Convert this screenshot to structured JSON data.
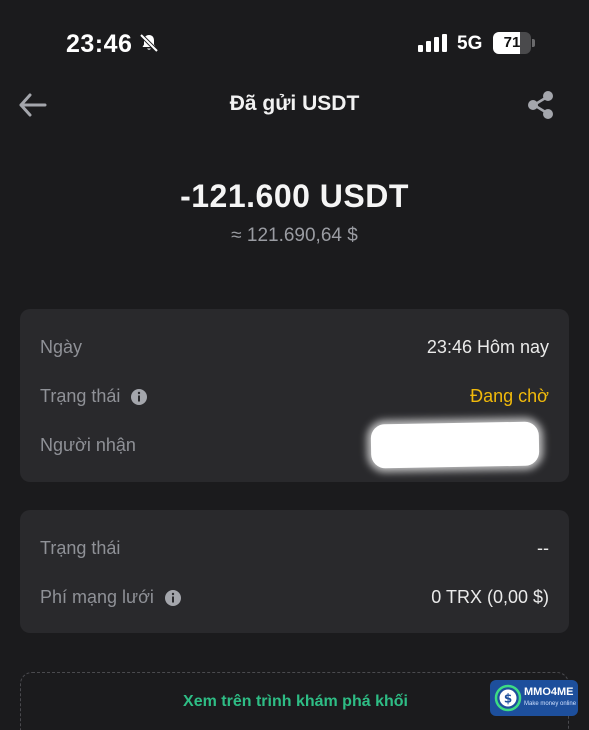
{
  "status_bar": {
    "time": "23:46",
    "network": "5G",
    "battery": "71",
    "battery_level": 0.71,
    "icons": [
      "bell-slash-icon",
      "cellular-signal-icon",
      "battery-icon"
    ]
  },
  "header": {
    "title": "Đã gửi USDT",
    "back_icon": "arrow-left-icon",
    "share_icon": "share-icon"
  },
  "summary": {
    "amount": "-121.600 USDT",
    "fiat": "≈ 121.690,64 $"
  },
  "details": {
    "date_label": "Ngày",
    "date_value": "23:46 Hôm nay",
    "status_label": "Trạng thái",
    "status_value": "Đang chờ",
    "recipient_label": "Người nhận"
  },
  "network": {
    "status_label": "Trạng thái",
    "status_value": "--",
    "fee_label": "Phí mạng lưới",
    "fee_value": "0 TRX (0,00 $)"
  },
  "explorer": {
    "label": "Xem trên trình khám phá khối"
  },
  "watermark": {
    "brand": "MMO4ME",
    "tagline": "Make money online"
  },
  "colors": {
    "background": "#1b1b1d",
    "card": "#29292c",
    "pending": "#f0b90b",
    "link": "#2ebd85"
  }
}
